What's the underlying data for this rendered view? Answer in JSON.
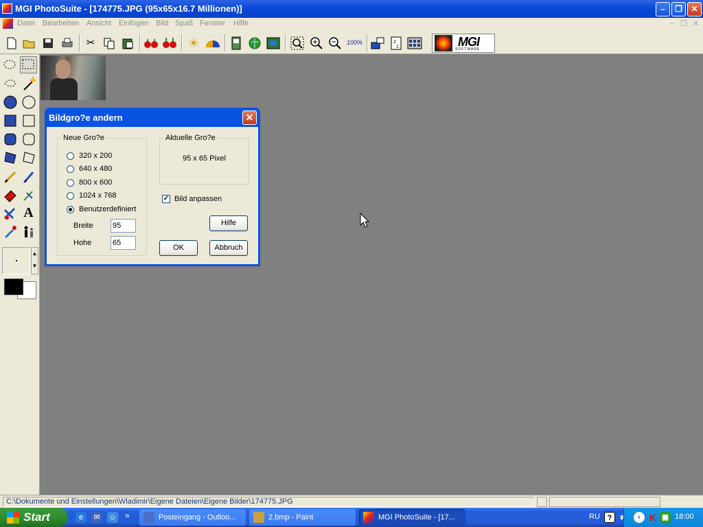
{
  "window": {
    "title": "MGI PhotoSuite - [174775.JPG (95x65x16.7 Millionen)]",
    "controls": [
      "minimize",
      "restore",
      "close"
    ]
  },
  "menu": {
    "items": [
      "Datei",
      "Bearbeiten",
      "Ansicht",
      "Einfügen",
      "Bild",
      "Spaß",
      "Fenster",
      "Hilfe"
    ]
  },
  "toolbar": {
    "buttons": [
      {
        "name": "new-icon"
      },
      {
        "name": "open-icon"
      },
      {
        "name": "save-icon"
      },
      {
        "name": "print-icon"
      },
      {
        "name": "cut-icon"
      },
      {
        "name": "copy-icon"
      },
      {
        "name": "paste-icon"
      },
      {
        "name": "red-eye-icon"
      },
      {
        "name": "red-eye-remove-icon"
      },
      {
        "name": "brightness-icon"
      },
      {
        "name": "color-icon"
      },
      {
        "name": "collage-icon"
      },
      {
        "name": "globe-icon"
      },
      {
        "name": "frame-icon"
      },
      {
        "name": "zoom-select-icon"
      },
      {
        "name": "zoom-in-icon"
      },
      {
        "name": "zoom-out-icon"
      },
      {
        "name": "zoom-100-icon"
      },
      {
        "name": "camera-icon"
      },
      {
        "name": "calendar-icon"
      },
      {
        "name": "album-icon"
      }
    ],
    "zoom_100_label": "100%",
    "logo_text": "MGI",
    "logo_subtext": "SOFTWARE"
  },
  "palette": {
    "tools": [
      "ellipse-select-icon",
      "rect-select-icon",
      "lasso-icon",
      "magic-wand-icon",
      "filled-circle-icon",
      "circle-icon",
      "filled-rect-icon",
      "rect-icon",
      "filled-rounded-rect-icon",
      "rounded-rect-icon",
      "filled-polygon-icon",
      "polygon-icon",
      "pencil-icon",
      "brush-icon",
      "eraser-icon",
      "clone-icon",
      "fill-icon",
      "text-icon",
      "eyedropper-icon",
      "people-icon"
    ],
    "text_tool_glyph": "A",
    "foreground_color": "#000000",
    "background_color": "#ffffff"
  },
  "dialog": {
    "title": "Bildgro?e andern",
    "new_size_group": "Neue Gro?e",
    "options": [
      {
        "label": "320 x 200",
        "selected": false
      },
      {
        "label": "640 x 480",
        "selected": false
      },
      {
        "label": "800 x 600",
        "selected": false
      },
      {
        "label": "1024 x 768",
        "selected": false
      },
      {
        "label": "Benutzerdefiniert",
        "selected": true
      }
    ],
    "width_label": "Breite",
    "width_value": "95",
    "height_label": "Hohe",
    "height_value": "65",
    "current_size_group": "Aktuelle Gro?e",
    "current_size_value": "95 x 65 Pixel",
    "fit_image_label": "Bild anpassen",
    "fit_image_checked": true,
    "help_button": "Hilfe",
    "ok_button": "OK",
    "cancel_button": "Abbruch"
  },
  "statusbar": {
    "path": "C:\\Dokumente und Einstellungen\\Wladimir\\Eigene Dateien\\Eigene Bilder\\174775.JPG"
  },
  "taskbar": {
    "start_label": "Start",
    "quick_launch": [
      "ie-icon",
      "outlook-icon",
      "messenger-icon"
    ],
    "quick_launch_more": "»",
    "tasks": [
      {
        "label": "Posteingang - Outloo...",
        "active": false
      },
      {
        "label": "2.bmp - Paint",
        "active": false
      },
      {
        "label": "MGI PhotoSuite - [17...",
        "active": true
      }
    ],
    "language": "RU",
    "help_glyph": "?",
    "kaspersky_glyph": "K",
    "clock": "18:00"
  }
}
